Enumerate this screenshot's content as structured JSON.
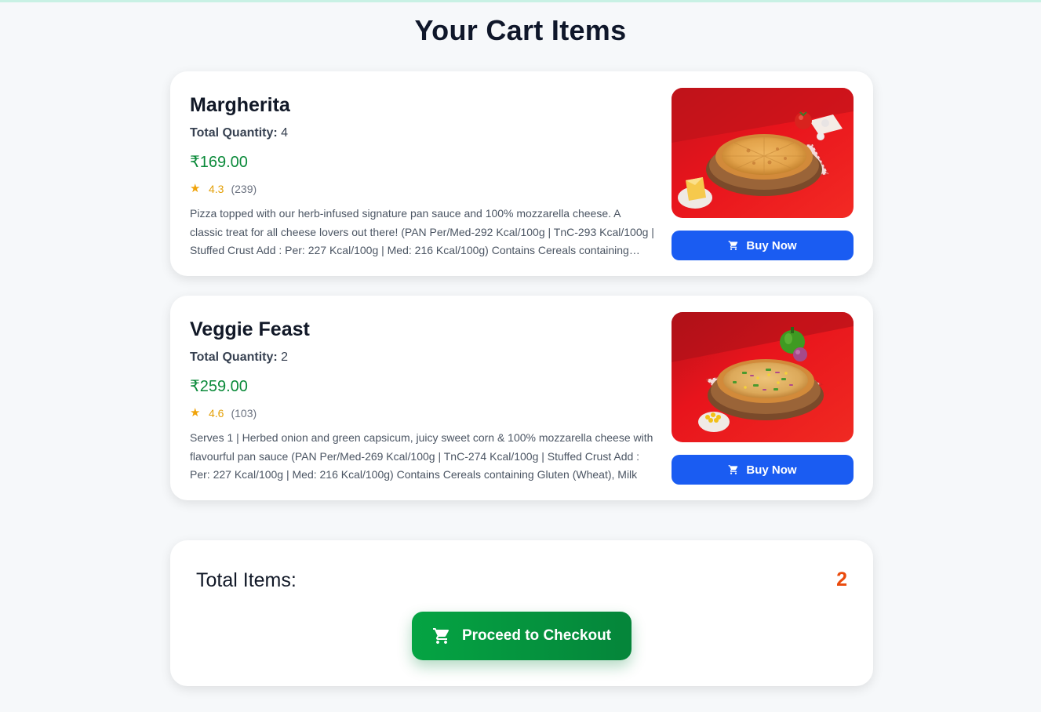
{
  "page": {
    "title": "Your Cart Items"
  },
  "cart": {
    "items": [
      {
        "name": "Margherita",
        "quantity_label": "Total Quantity:",
        "quantity": "4",
        "price": "₹169.00",
        "rating": "4.3",
        "reviews": "(239)",
        "description": "Pizza topped with our herb-infused signature pan sauce and 100% mozzarella cheese. A classic treat for all cheese lovers out there! (PAN Per/Med-292 Kcal/100g | TnC-293 Kcal/100g | Stuffed Crust Add : Per: 227 Kcal/100g | Med: 216 Kcal/100g) Contains Cereals containing Gluten (Wheat), Milk",
        "image_icon": "margherita-pizza-image",
        "buy_label": "Buy Now"
      },
      {
        "name": "Veggie Feast",
        "quantity_label": "Total Quantity:",
        "quantity": "2",
        "price": "₹259.00",
        "rating": "4.6",
        "reviews": "(103)",
        "description": "Serves 1 | Herbed onion and green capsicum, juicy sweet corn & 100% mozzarella cheese with flavourful pan sauce (PAN Per/Med-269 Kcal/100g | TnC-274 Kcal/100g | Stuffed Crust Add : Per: 227 Kcal/100g | Med: 216 Kcal/100g) Contains Cereals containing Gluten (Wheat), Milk",
        "image_icon": "veggie-feast-pizza-image",
        "buy_label": "Buy Now"
      }
    ]
  },
  "summary": {
    "total_label": "Total Items:",
    "total_count": "2",
    "checkout_label": "Proceed to Checkout"
  },
  "colors": {
    "accent_blue": "#1a5cf2",
    "price_green": "#0b8a3a",
    "checkout_green": "#05a443",
    "count_orange": "#ea4a0c",
    "star_yellow": "#f0a30a"
  }
}
